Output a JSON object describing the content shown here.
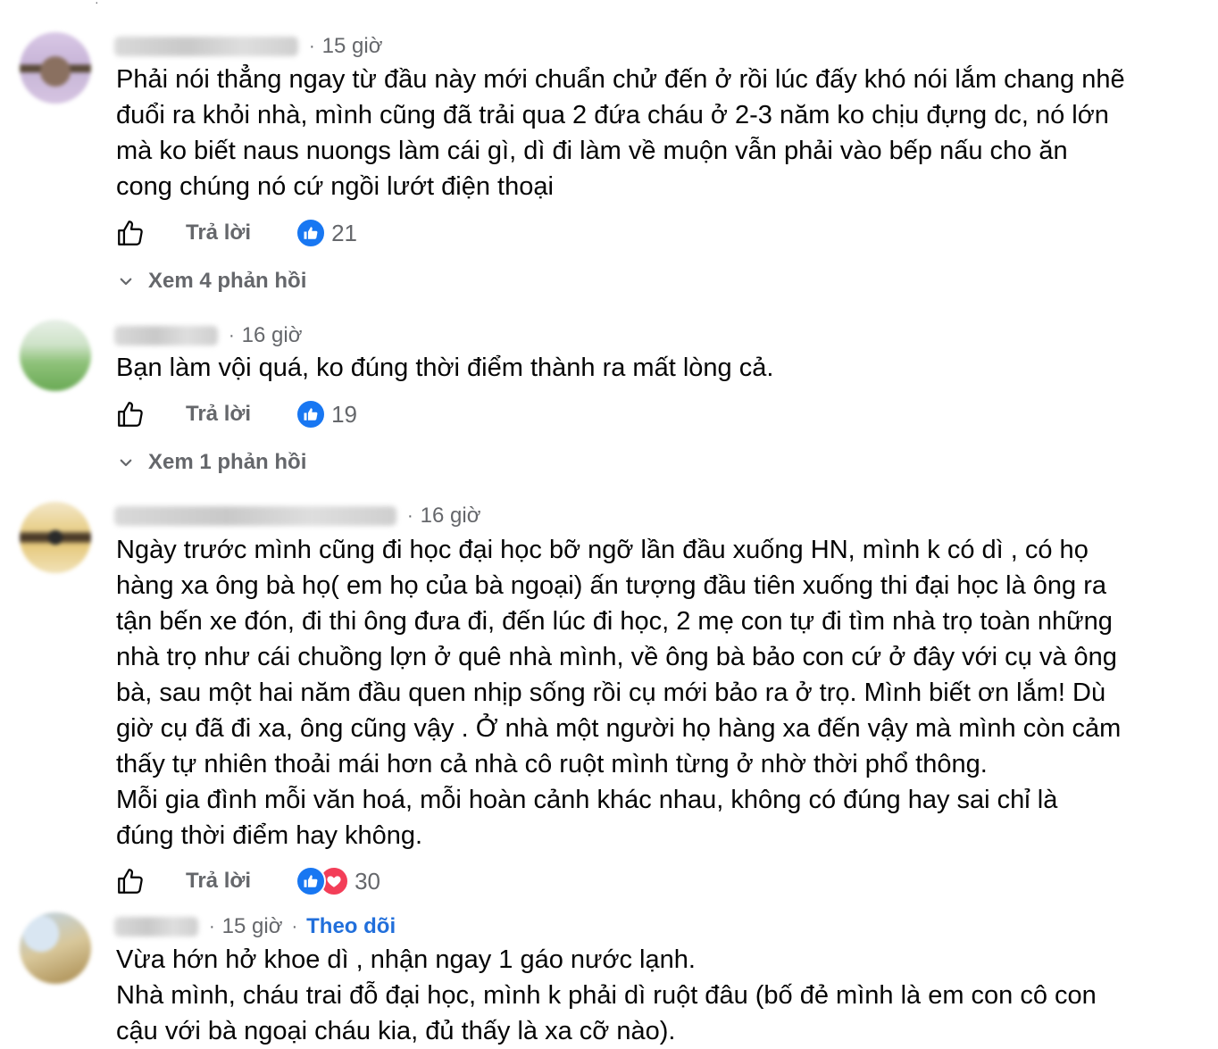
{
  "comments": [
    {
      "time": "15 giờ",
      "follow_label": "",
      "lines": [
        "Phải nói thẳng ngay từ đầu này mới chuẩn chử đến ở rồi lúc đấy khó nói lắm chang nhẽ",
        "đuổi ra khỏi nhà, mình cũng đã trải qua 2 đứa cháu ở 2-3 năm ko chịu đựng dc, nó lớn",
        "mà ko biết naus nuongs làm cái gì, dì đi làm về muộn vẫn phải vào bếp nấu cho ăn",
        "cong chúng nó cứ ngồi lướt điện thoại"
      ],
      "reply_label": "Trả lời",
      "reaction_count": "21",
      "reactions": [
        "like"
      ],
      "replies_label": "Xem 4 phản hồi"
    },
    {
      "time": "16 giờ",
      "follow_label": "",
      "lines": [
        "Bạn làm vội quá, ko đúng thời điểm thành ra mất lòng cả."
      ],
      "reply_label": "Trả lời",
      "reaction_count": "19",
      "reactions": [
        "like"
      ],
      "replies_label": "Xem 1 phản hồi"
    },
    {
      "time": "16 giờ",
      "follow_label": "",
      "lines": [
        "Ngày trước mình cũng đi học đại học bỡ ngỡ lần đầu xuống HN, mình k có dì , có họ",
        "hàng xa ông bà họ( em họ của bà ngoại) ấn tượng đầu tiên xuống thi đại học là ông ra",
        "tận bến xe đón, đi thi ông đưa đi, đến lúc đi học, 2 mẹ con tự đi tìm nhà trọ toàn những",
        "nhà trọ như cái chuồng lợn ở quê nhà mình, về ông bà bảo con cứ ở đây với cụ và ông",
        "bà, sau một hai năm đầu quen nhịp sống rồi cụ mới bảo ra ở trọ. Mình biết ơn lắm! Dù",
        "giờ cụ đã đi xa, ông cũng vậy . Ở nhà một người họ hàng xa đến vậy mà mình còn cảm",
        "thấy tự nhiên thoải mái hơn cả nhà cô ruột mình từng ở nhờ thời phổ thông.",
        "Mỗi gia đình mỗi văn hoá, mỗi hoàn cảnh khác nhau, không có đúng hay sai chỉ là",
        "đúng thời điểm hay không."
      ],
      "reply_label": "Trả lời",
      "reaction_count": "30",
      "reactions": [
        "like",
        "love"
      ],
      "replies_label": ""
    },
    {
      "time": "15 giờ",
      "follow_label": "Theo dõi",
      "lines": [
        "Vừa hớn hở khoe dì , nhận ngay 1 gáo nước lạnh.",
        "Nhà mình, cháu trai đỗ đại học, mình k phải dì ruột đâu (bố đẻ mình là em con cô con",
        "cậu với bà ngoại cháu kia, đủ thấy là xa cỡ nào)."
      ],
      "reply_label": "",
      "reaction_count": "",
      "reactions": [],
      "replies_label": ""
    }
  ],
  "colors": {
    "text": "#050505",
    "secondary": "#65676b",
    "link": "#216fdb",
    "like": "#1877f2",
    "love": "#f33e58"
  },
  "icons": {
    "like_outline": "thumbs-up-outline-icon",
    "like_reaction": "like-reaction-icon",
    "love_reaction": "love-reaction-icon",
    "chevron": "chevron-down-icon"
  }
}
